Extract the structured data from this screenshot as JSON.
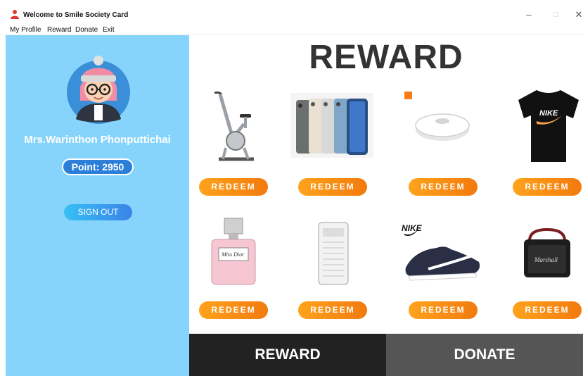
{
  "window": {
    "title": "Welcome to Smile Society Card",
    "controls": {
      "minimize": "–",
      "maximize": "□",
      "close": "✕"
    }
  },
  "menu": [
    "My Profile",
    "Reward",
    "Donate",
    "Exit"
  ],
  "sidebar": {
    "user_name": "Mrs.Warinthon Phonputtichai",
    "points": "Point: 2950",
    "signout_label": "SIGN OUT"
  },
  "main": {
    "title": "REWARD",
    "products": [
      {
        "icon": "exercise-bike-icon",
        "redeem": "REDEEM"
      },
      {
        "icon": "smartphones-icon",
        "redeem": "REDEEM"
      },
      {
        "icon": "robot-vacuum-icon",
        "redeem": "REDEEM",
        "badge": "mi"
      },
      {
        "icon": "tshirt-icon",
        "redeem": "REDEEM",
        "logo": "NIKE"
      },
      {
        "icon": "perfume-icon",
        "redeem": "REDEEM",
        "label": "Miss Dior"
      },
      {
        "icon": "air-purifier-icon",
        "redeem": "REDEEM"
      },
      {
        "icon": "sneaker-icon",
        "redeem": "REDEEM",
        "logo": "NIKE"
      },
      {
        "icon": "speaker-icon",
        "redeem": "REDEEM",
        "label": "Marshall"
      }
    ],
    "bottom_reward": "REWARD",
    "bottom_donate": "DONATE"
  },
  "colors": {
    "sidebar": "#86d4fb",
    "redeem": "#f7931a",
    "points_pill": "#2c7fd9",
    "bottom_reward": "#222222",
    "bottom_donate": "#555555"
  }
}
